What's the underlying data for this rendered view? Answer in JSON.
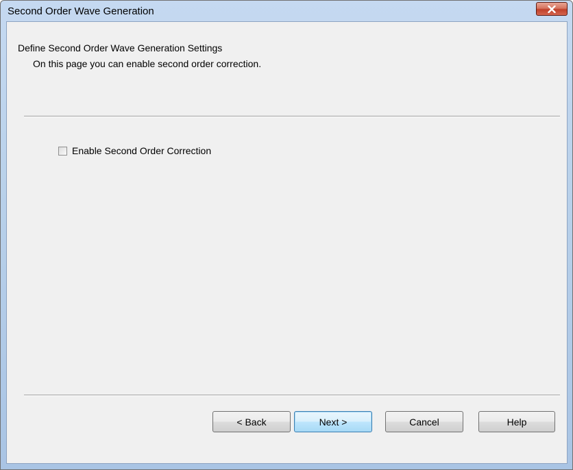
{
  "window": {
    "title": "Second Order Wave Generation"
  },
  "header": {
    "title": "Define Second Order Wave Generation Settings",
    "subtitle": "On this page you can enable second order correction."
  },
  "options": {
    "enable_correction": {
      "label": "Enable Second Order Correction",
      "checked": false
    }
  },
  "buttons": {
    "back": "< Back",
    "next": "Next >",
    "cancel": "Cancel",
    "help": "Help"
  },
  "icons": {
    "close": "close-icon"
  },
  "colors": {
    "close_button": "#c0402a",
    "dialog_background": "#f0f0f0",
    "default_button_border": "#3c7fb1"
  }
}
